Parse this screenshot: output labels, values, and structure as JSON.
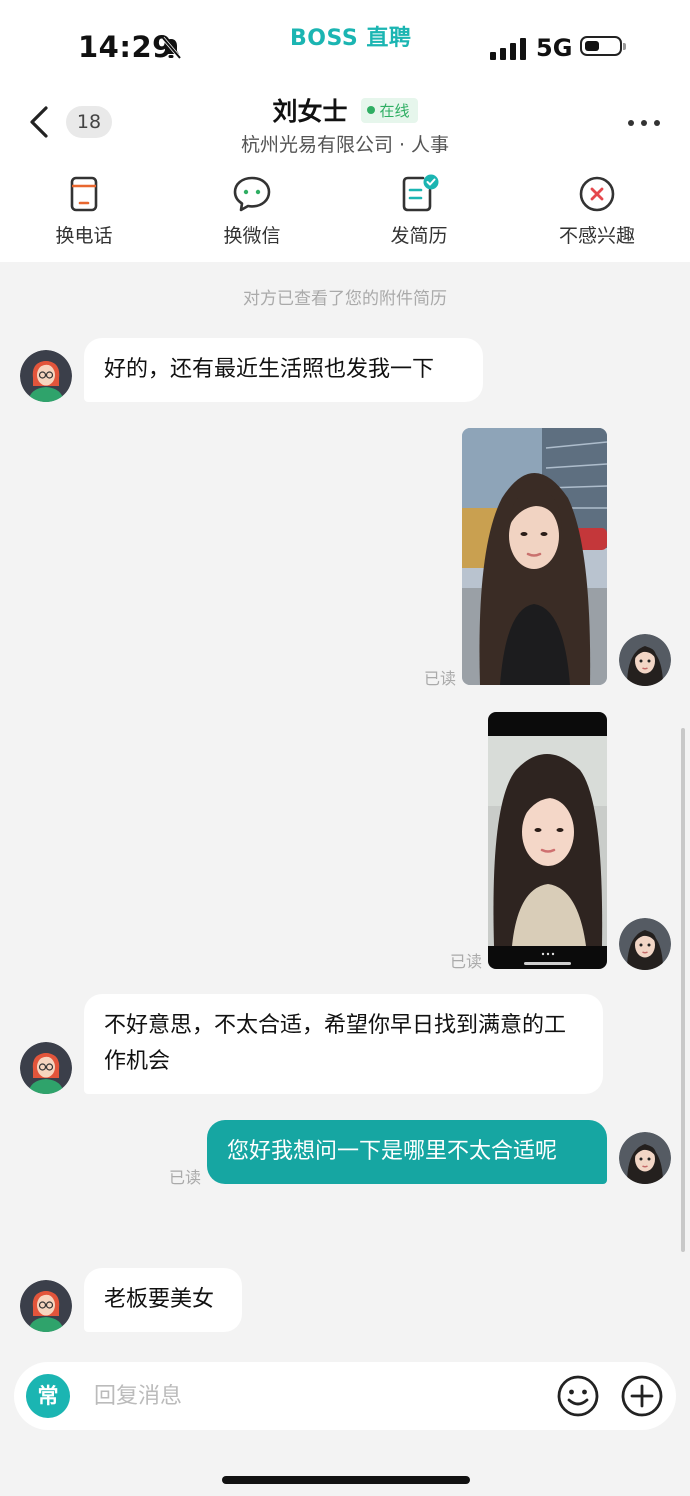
{
  "status_bar": {
    "time": "14:29",
    "brand": "BOSS 直聘",
    "network": "5G",
    "silent_icon": "bell-slash-icon"
  },
  "header": {
    "unread_count": "18",
    "contact_name": "刘女士",
    "online_label": "在线",
    "company_role": "杭州光易有限公司 · 人事"
  },
  "actions": [
    {
      "label": "换电话",
      "icon": "phone-swap-icon"
    },
    {
      "label": "换微信",
      "icon": "wechat-icon"
    },
    {
      "label": "发简历",
      "icon": "resume-icon"
    },
    {
      "label": "不感兴趣",
      "icon": "not-interested-icon"
    }
  ],
  "chat": {
    "system_note": "对方已查看了您的附件简历",
    "read_label": "已读",
    "messages": [
      {
        "from": "recruiter",
        "type": "text",
        "text": "好的，还有最近生活照也发我一下"
      },
      {
        "from": "me",
        "type": "photo",
        "status": "已读"
      },
      {
        "from": "me",
        "type": "photo",
        "status": "已读"
      },
      {
        "from": "recruiter",
        "type": "text",
        "text": "不好意思，不太合适，希望你早日找到满意的工作机会"
      },
      {
        "from": "me",
        "type": "text",
        "text": "您好我想问一下是哪里不太合适呢",
        "status": "已读"
      },
      {
        "from": "recruiter",
        "type": "text",
        "text": "老板要美女"
      }
    ]
  },
  "input": {
    "quick_phrase_label": "常",
    "placeholder": "回复消息"
  },
  "colors": {
    "brand": "#1bb5b2",
    "my_bubble": "#16a6a2",
    "online_green": "#2fae63"
  }
}
